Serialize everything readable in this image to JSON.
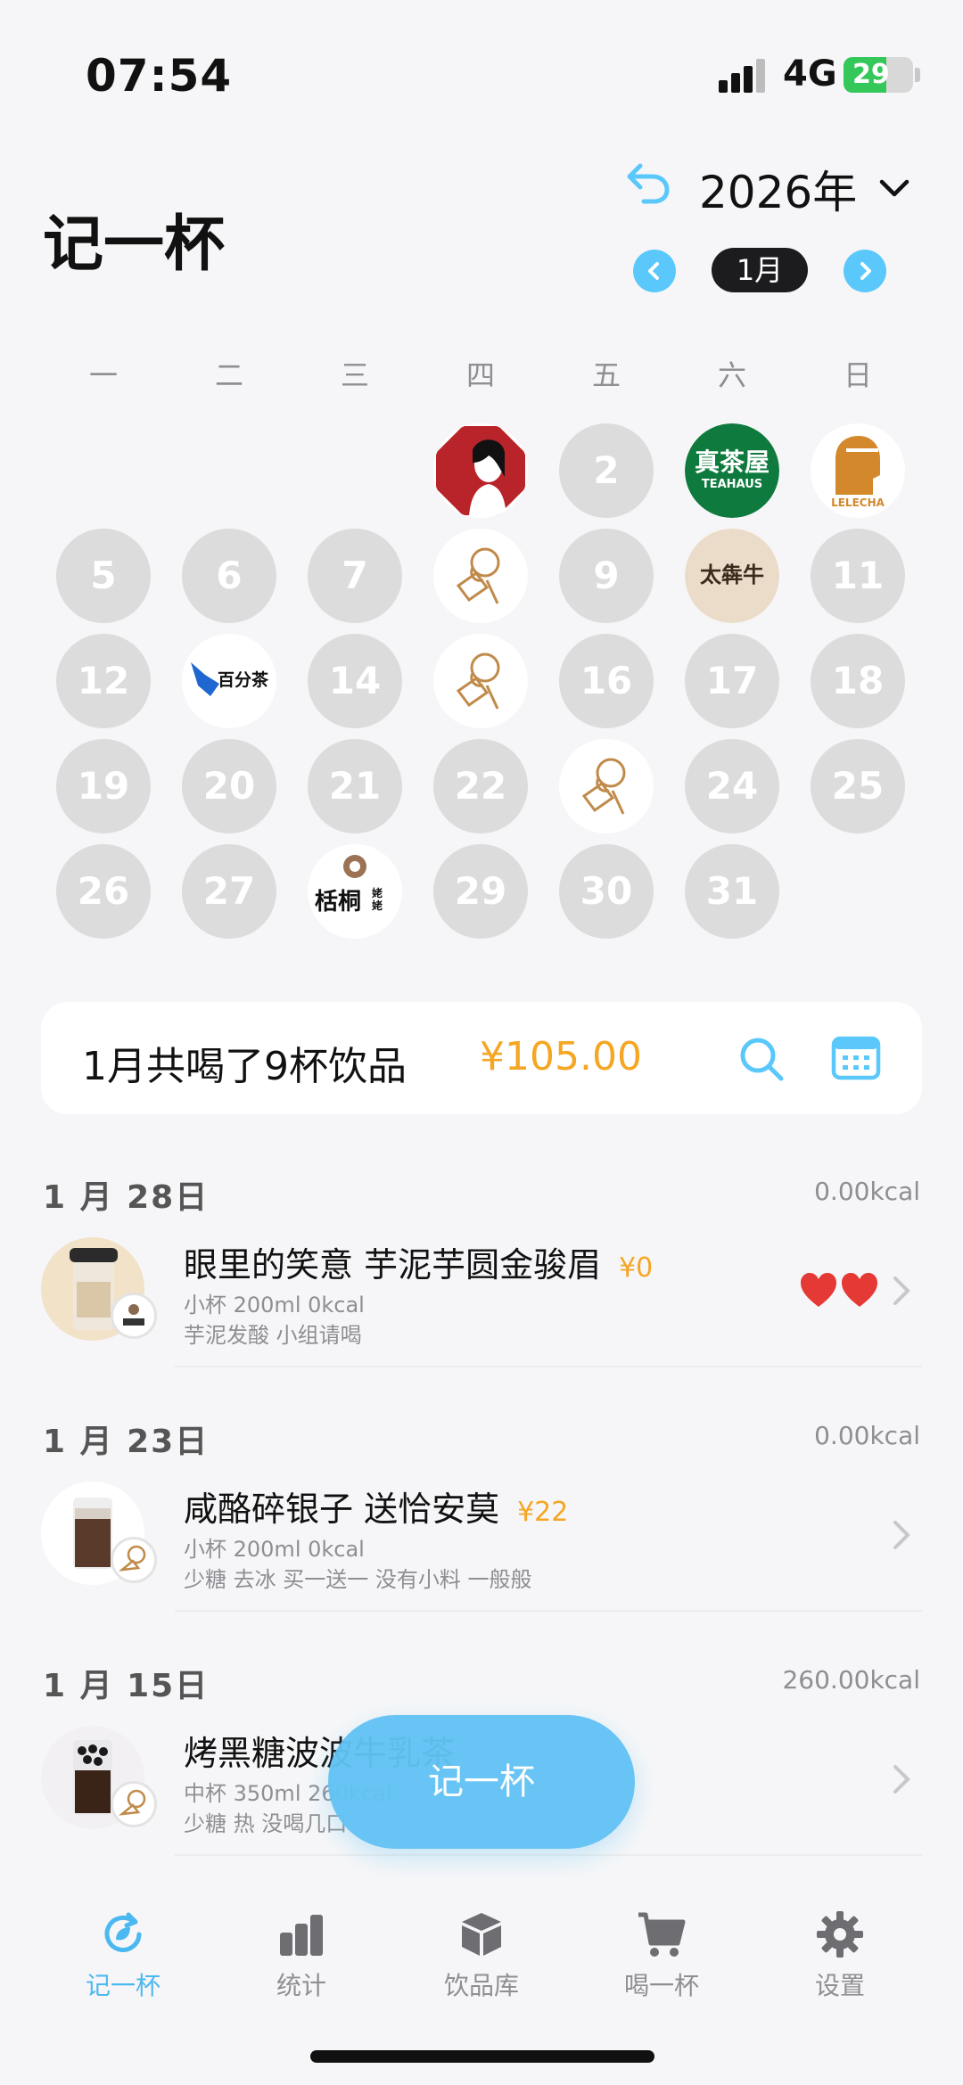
{
  "status_bar": {
    "time": "07:54",
    "network": "4G",
    "battery": "29"
  },
  "header": {
    "title": "记一杯",
    "year": "2026年",
    "month": "1月"
  },
  "calendar": {
    "weekdays": [
      "一",
      "二",
      "三",
      "四",
      "五",
      "六",
      "日"
    ],
    "days": [
      {
        "day": "1",
        "logo": "chayan-yuese-logo"
      },
      {
        "day": "2",
        "logo": null
      },
      {
        "day": "3",
        "logo": "zhenchawu-logo",
        "logo_text": "真茶屋",
        "logo_sub": "TEAHAUS"
      },
      {
        "day": "4",
        "logo": "lelecha-logo",
        "logo_text": "LELECHA"
      },
      {
        "day": "5",
        "logo": null
      },
      {
        "day": "6",
        "logo": null
      },
      {
        "day": "7",
        "logo": null
      },
      {
        "day": "8",
        "logo": "drinking-person-logo"
      },
      {
        "day": "9",
        "logo": null
      },
      {
        "day": "10",
        "logo": "taihuniu-logo",
        "logo_text": "太犇牛"
      },
      {
        "day": "11",
        "logo": null
      },
      {
        "day": "12",
        "logo": null
      },
      {
        "day": "13",
        "logo": "baifencha-logo",
        "logo_text": "百分茶"
      },
      {
        "day": "14",
        "logo": null
      },
      {
        "day": "15",
        "logo": "drinking-person-logo"
      },
      {
        "day": "16",
        "logo": null
      },
      {
        "day": "17",
        "logo": null
      },
      {
        "day": "18",
        "logo": null
      },
      {
        "day": "19",
        "logo": null
      },
      {
        "day": "20",
        "logo": null
      },
      {
        "day": "21",
        "logo": null
      },
      {
        "day": "22",
        "logo": null
      },
      {
        "day": "23",
        "logo": "drinking-person-logo"
      },
      {
        "day": "24",
        "logo": null
      },
      {
        "day": "25",
        "logo": null
      },
      {
        "day": "26",
        "logo": null
      },
      {
        "day": "27",
        "logo": null
      },
      {
        "day": "28",
        "logo": "kuotong-logo",
        "logo_text": "栝桐",
        "logo_side": "姥姥"
      },
      {
        "day": "29",
        "logo": null
      },
      {
        "day": "30",
        "logo": null
      },
      {
        "day": "31",
        "logo": null
      }
    ]
  },
  "summary": {
    "text": "1月共喝了9杯饮品",
    "amount": "¥105.00"
  },
  "records": [
    {
      "date": "1 月 28日",
      "kcal": "0.00kcal",
      "name": "眼里的笑意 芋泥芋圆金骏眉",
      "price": "¥0",
      "line1": "小杯 200ml  0kcal",
      "line2": "芋泥发酸 小组请喝",
      "rating": "hearts-2"
    },
    {
      "date": "1 月 23日",
      "kcal": "0.00kcal",
      "name": "咸酪碎银子 送恰安莫",
      "price": "¥22",
      "line1": "小杯 200ml  0kcal",
      "line2": "少糖  去冰  买一送一 没有小料 一般般"
    },
    {
      "date": "1 月 15日",
      "kcal": "260.00kcal",
      "name": "烤黑糖波波牛乳茶",
      "price": "",
      "line1": "中杯 350ml  260kcal",
      "line2": "少糖  热  没喝几口"
    }
  ],
  "fab": {
    "label": "记一杯"
  },
  "tabs": [
    {
      "label": "记一杯",
      "icon": "refresh-leaf-icon",
      "active": true
    },
    {
      "label": "统计",
      "icon": "bar-chart-icon"
    },
    {
      "label": "饮品库",
      "icon": "box-icon"
    },
    {
      "label": "喝一杯",
      "icon": "cart-icon"
    },
    {
      "label": "设置",
      "icon": "gear-icon"
    }
  ],
  "colors": {
    "accent": "#5ac8fa",
    "price": "#f5a623",
    "day_empty": "#dcdcdc",
    "heart": "#e53935"
  }
}
